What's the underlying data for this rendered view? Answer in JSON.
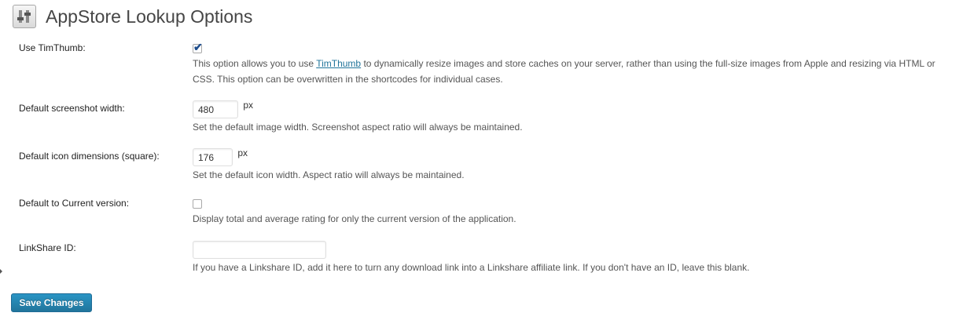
{
  "header": {
    "title": "AppStore Lookup Options",
    "icon": "settings-sliders-icon"
  },
  "options": {
    "timthumb": {
      "label": "Use TimThumb:",
      "checked": true,
      "desc_before": "This option allows you to use ",
      "link_text": "TimThumb",
      "desc_after": " to dynamically resize images and store caches on your server, rather than using the full-size images from Apple and resizing via HTML or CSS. This option can be overwritten in the shortcodes for individual cases."
    },
    "screenshot_width": {
      "label": "Default screenshot width:",
      "value": "480",
      "unit": "px",
      "desc": "Set the default image width. Screenshot aspect ratio will always be maintained."
    },
    "icon_dimensions": {
      "label": "Default icon dimensions (square):",
      "value": "176",
      "unit": "px",
      "desc": "Set the default icon width. Aspect ratio will always be maintained."
    },
    "current_version": {
      "label": "Default to Current version:",
      "checked": false,
      "desc": "Display total and average rating for only the current version of the application."
    },
    "linkshare": {
      "label": "LinkShare ID:",
      "value": "",
      "desc": "If you have a Linkshare ID, add it here to turn any download link into a Linkshare affiliate link. If you don't have an ID, leave this blank."
    }
  },
  "actions": {
    "save_label": "Save Changes"
  },
  "colors": {
    "accent": "#21759b",
    "button": "#2a95c5"
  }
}
